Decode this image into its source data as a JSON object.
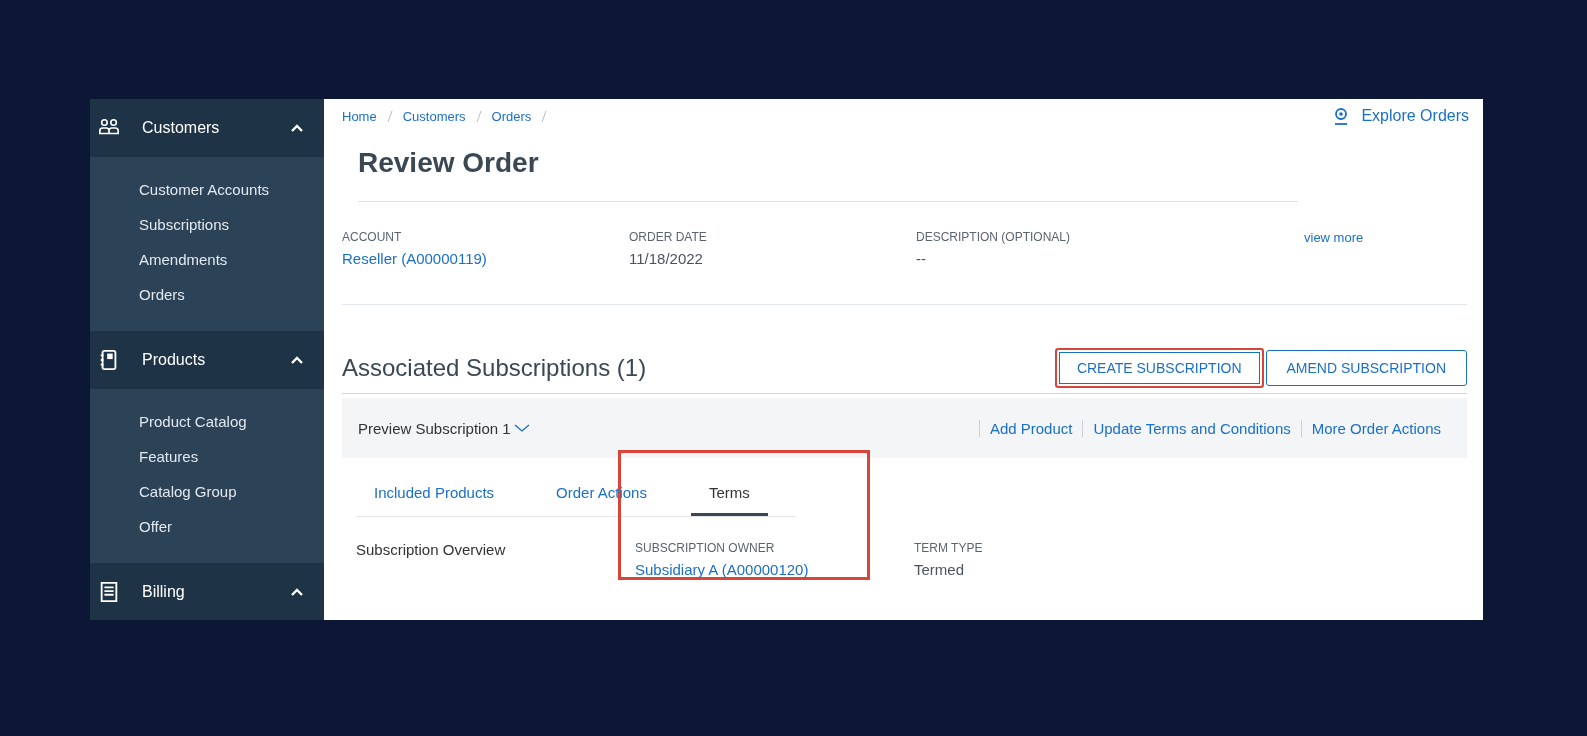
{
  "sidebar": {
    "groups": [
      {
        "label": "Customers",
        "expanded": true,
        "items": [
          "Customer Accounts",
          "Subscriptions",
          "Amendments",
          "Orders"
        ]
      },
      {
        "label": "Products",
        "expanded": true,
        "items": [
          "Product Catalog",
          "Features",
          "Catalog Group",
          "Offer"
        ]
      },
      {
        "label": "Billing",
        "expanded": true
      }
    ]
  },
  "breadcrumb": [
    "Home",
    "Customers",
    "Orders"
  ],
  "explore_link": "Explore Orders",
  "page_title": "Review Order",
  "order_fields": [
    {
      "label": "ACCOUNT",
      "value": "Reseller (A00000119)",
      "kind": "link"
    },
    {
      "label": "ORDER DATE",
      "value": "11/18/2022",
      "kind": "text"
    },
    {
      "label": "DESCRIPTION (OPTIONAL)",
      "value": "--",
      "kind": "text"
    }
  ],
  "view_more": "view more",
  "subscriptions": {
    "title": "Associated Subscriptions (1)",
    "buttons": [
      {
        "label": "CREATE SUBSCRIPTION",
        "highlighted": true
      },
      {
        "label": "AMEND SUBSCRIPTION",
        "highlighted": false
      }
    ],
    "preview": "Preview Subscription 1",
    "actions": [
      "Add Product",
      "Update Terms and Conditions",
      "More Order Actions"
    ],
    "tabs": [
      {
        "label": "Included Products",
        "selected": false
      },
      {
        "label": "Order Actions",
        "selected": false
      },
      {
        "label": "Terms",
        "selected": true
      }
    ],
    "terms_highlighted": true,
    "overview_label": "Subscription Overview",
    "terms": [
      {
        "label": "SUBSCRIPTION OWNER",
        "value": "Subsidiary A (A00000120)",
        "kind": "link"
      },
      {
        "label": "TERM TYPE",
        "value": "Termed",
        "kind": "text"
      }
    ]
  }
}
